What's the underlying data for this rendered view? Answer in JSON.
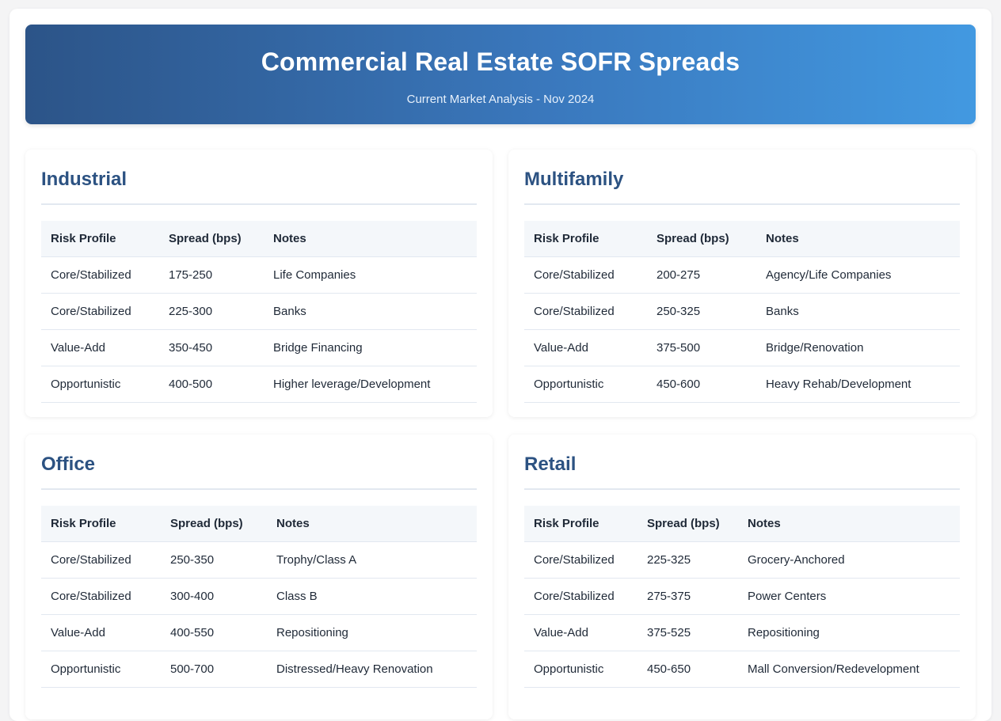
{
  "header": {
    "title": "Commercial Real Estate SOFR Spreads",
    "subtitle": "Current Market Analysis - Nov 2024"
  },
  "columns": {
    "risk": "Risk Profile",
    "spread": "Spread (bps)",
    "notes": "Notes"
  },
  "sections": [
    {
      "name": "Industrial",
      "rows": [
        {
          "risk": "Core/Stabilized",
          "spread": "175-250",
          "notes": "Life Companies"
        },
        {
          "risk": "Core/Stabilized",
          "spread": "225-300",
          "notes": "Banks"
        },
        {
          "risk": "Value-Add",
          "spread": "350-450",
          "notes": "Bridge Financing"
        },
        {
          "risk": "Opportunistic",
          "spread": "400-500",
          "notes": "Higher leverage/Development"
        }
      ]
    },
    {
      "name": "Multifamily",
      "rows": [
        {
          "risk": "Core/Stabilized",
          "spread": "200-275",
          "notes": "Agency/Life Companies"
        },
        {
          "risk": "Core/Stabilized",
          "spread": "250-325",
          "notes": "Banks"
        },
        {
          "risk": "Value-Add",
          "spread": "375-500",
          "notes": "Bridge/Renovation"
        },
        {
          "risk": "Opportunistic",
          "spread": "450-600",
          "notes": "Heavy Rehab/Development"
        }
      ]
    },
    {
      "name": "Office",
      "rows": [
        {
          "risk": "Core/Stabilized",
          "spread": "250-350",
          "notes": "Trophy/Class A"
        },
        {
          "risk": "Core/Stabilized",
          "spread": "300-400",
          "notes": "Class B"
        },
        {
          "risk": "Value-Add",
          "spread": "400-550",
          "notes": "Repositioning"
        },
        {
          "risk": "Opportunistic",
          "spread": "500-700",
          "notes": "Distressed/Heavy Renovation"
        }
      ]
    },
    {
      "name": "Retail",
      "rows": [
        {
          "risk": "Core/Stabilized",
          "spread": "225-325",
          "notes": "Grocery-Anchored"
        },
        {
          "risk": "Core/Stabilized",
          "spread": "275-375",
          "notes": "Power Centers"
        },
        {
          "risk": "Value-Add",
          "spread": "375-525",
          "notes": "Repositioning"
        },
        {
          "risk": "Opportunistic",
          "spread": "450-650",
          "notes": "Mall Conversion/Redevelopment"
        }
      ]
    }
  ]
}
